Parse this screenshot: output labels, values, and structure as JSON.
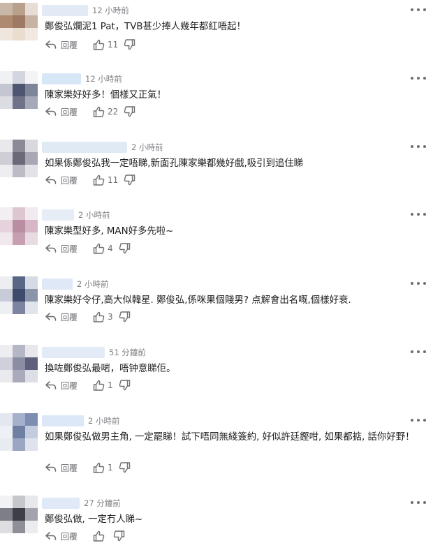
{
  "comments": [
    {
      "time": "12 小時前",
      "text": "鄭俊弘爛泥1 Pat，TVB甚少捧人幾年都紅唔起！",
      "likes": "11",
      "reply_label": "回覆",
      "avatar_colors": [
        "#c9b8a8",
        "#b8a08a",
        "#e7ddd6",
        "#b08a70",
        "#9c7a64",
        "#c8b2a2",
        "#efe6de",
        "#eadccf",
        "#f1e9e1"
      ],
      "name_color": "#dfe8f5"
    },
    {
      "time": "12 小時前",
      "text": "陳家樂好好多！個樣又正氣！",
      "likes": "22",
      "reply_label": "回覆",
      "avatar_colors": [
        "#f0f1f3",
        "#d3d6de",
        "#f4f4f6",
        "#c4c7d1",
        "#4d5570",
        "#7f8599",
        "#dcdde3",
        "#6f7389",
        "#a5a9b8"
      ],
      "name_color": "#d3e4f7"
    },
    {
      "time": "2 小時前",
      "text": "如果係鄭俊弘我一定唔睇,新面孔陳家樂都幾好戲,吸引到追住睇",
      "likes": "11",
      "reply_label": "回覆",
      "avatar_colors": [
        "#e9e8ec",
        "#8d8a98",
        "#d9d8de",
        "#cfcdd6",
        "#6b6878",
        "#a9a7b4",
        "#eeedf0",
        "#bdbbc6",
        "#e3e2e7"
      ],
      "name_color": "#dde8f4"
    },
    {
      "time": "2 小時前",
      "text": "陳家樂型好多, MAN好多先啦~",
      "likes": "4",
      "reply_label": "回覆",
      "avatar_colors": [
        "#f3eef1",
        "#dcc7d0",
        "#f1eaee",
        "#e6d2dc",
        "#b98da2",
        "#d9b6c5",
        "#f0e8ec",
        "#c69fb1",
        "#e8dbe1"
      ],
      "name_color": "#e3ebf6"
    },
    {
      "time": "2 小時前",
      "text": "陳家樂好令仔,高大似韓星. 鄭俊弘,係咪果個賤男? 点解會出名嘅,個樣好衰.",
      "likes": "3",
      "reply_label": "回覆",
      "avatar_colors": [
        "#eceef2",
        "#5a6685",
        "#d6dae4",
        "#c7ccd8",
        "#3f4b6b",
        "#8c94aa",
        "#edeff3",
        "#7c84a0",
        "#e1e4ea"
      ],
      "name_color": "#dbe6f5"
    },
    {
      "time": "51 分鐘前",
      "text": "換咗鄭俊弘最啱，唔钟意睇佢。",
      "likes": "1",
      "reply_label": "回覆",
      "avatar_colors": [
        "#eeeef2",
        "#b6b7c6",
        "#e7e7ec",
        "#cfd0dc",
        "#8b8da4",
        "#5f617c",
        "#e9e9ee",
        "#a9abbd",
        "#dedfe6"
      ],
      "name_color": "#e0e9f6"
    },
    {
      "time": "2 小時前",
      "text": "如果鄭俊弘做男主角, 一定罷睇！試下唔同無綫簽約, 好似許廷鏗咁, 如果都掂, 話你好野！",
      "likes": "1",
      "reply_label": "回覆",
      "avatar_colors": [
        "#e3e7f0",
        "#a5b1cc",
        "#7d8db0",
        "#eef0f5",
        "#6f7ea3",
        "#c3cbde",
        "#e8ebf2",
        "#9aa6c2",
        "#dfe3ec"
      ],
      "name_color": "#d8e5f6"
    },
    {
      "time": "27 分鐘前",
      "text": "鄭俊弘做, 一定冇人睇~",
      "likes": "",
      "reply_label": "回覆",
      "avatar_colors": [
        "#f2f2f4",
        "#c6c6cd",
        "#e8e8ec",
        "#7e7e88",
        "#3e3e48",
        "#a3a3ad",
        "#dddde2",
        "#8f8f99",
        "#ececef"
      ],
      "name_color": "#dce7f6"
    }
  ],
  "icons": {
    "reply": "reply-arrow-icon",
    "like": "thumbs-up-icon",
    "dislike": "thumbs-down-icon",
    "more": "more-horizontal-icon"
  }
}
